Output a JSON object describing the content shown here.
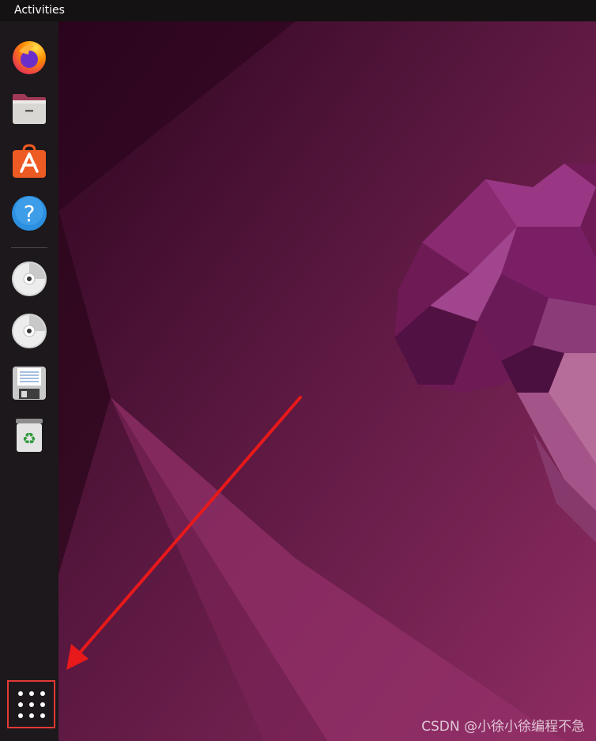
{
  "topbar": {
    "activities_label": "Activities"
  },
  "dock": {
    "items": [
      {
        "name": "Firefox",
        "icon": "firefox-icon"
      },
      {
        "name": "Files",
        "icon": "files-icon"
      },
      {
        "name": "Ubuntu Software",
        "icon": "software-store-icon"
      },
      {
        "name": "Help",
        "icon": "help-icon",
        "glyph": "?"
      },
      {
        "name": "Disc 1",
        "icon": "optical-disc-icon"
      },
      {
        "name": "Disc 2",
        "icon": "optical-disc-icon"
      },
      {
        "name": "Floppy",
        "icon": "floppy-disk-icon"
      },
      {
        "name": "Trash",
        "icon": "trash-icon",
        "glyph": "♻"
      }
    ],
    "show_apps_icon": "app-grid-icon"
  },
  "annotation": {
    "color": "#e8191a",
    "highlight_target": "show-applications-button"
  },
  "watermark": "CSDN @小徐小徐编程不急",
  "colors": {
    "dock_bg": "#1c181b",
    "topbar_bg": "#141212",
    "wallpaper_dark": "#2c0a1e",
    "wallpaper_mid": "#6a1e4c",
    "wallpaper_light": "#a43a76",
    "accent_red": "#e53935"
  }
}
